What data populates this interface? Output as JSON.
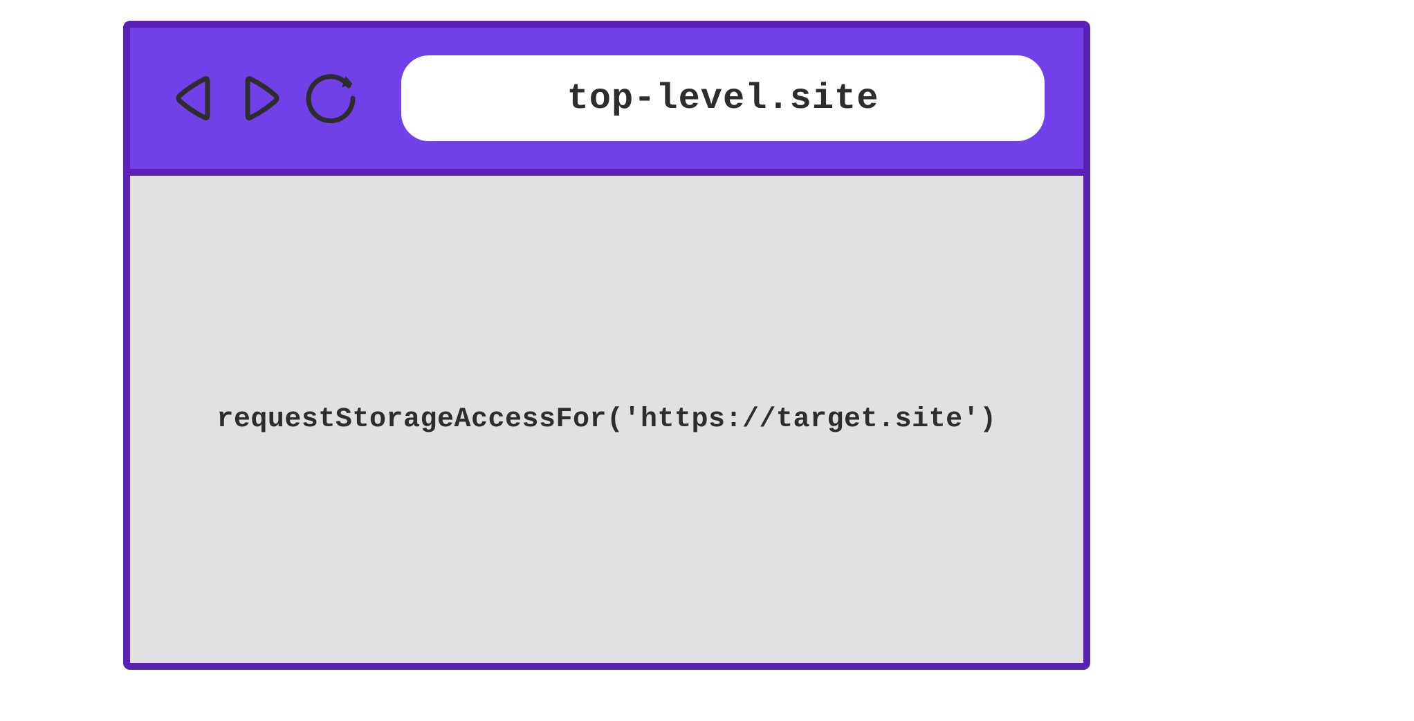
{
  "browser": {
    "address": "top-level.site",
    "viewport": {
      "code": "requestStorageAccessFor('https://target.site')"
    }
  },
  "colors": {
    "toolbar_bg": "#7140e8",
    "border": "#5b21b6",
    "viewport_bg": "#e1e1e1",
    "text": "#2d2d2d",
    "address_bg": "#ffffff"
  }
}
